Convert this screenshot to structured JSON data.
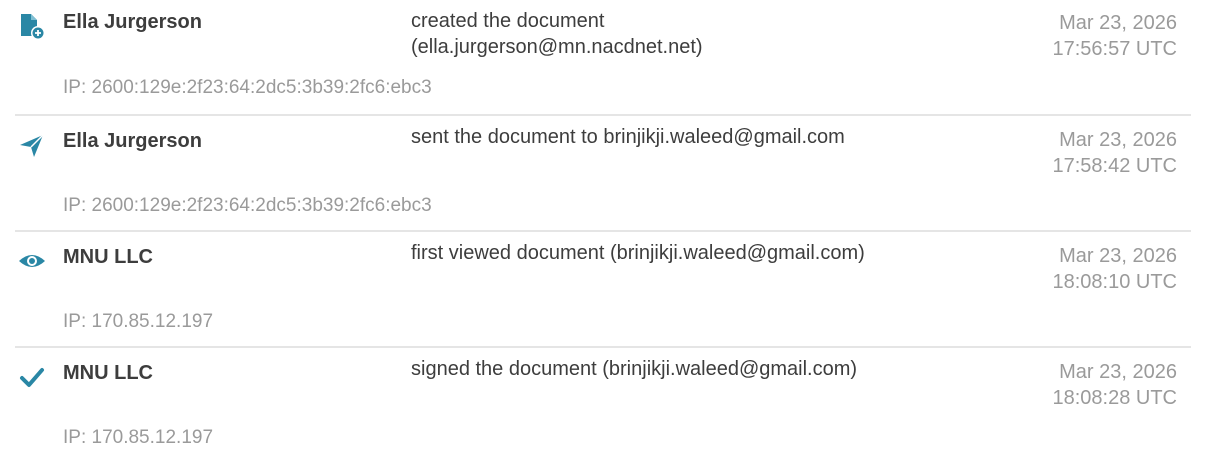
{
  "colors": {
    "accent": "#2a87a5",
    "text": "#3d3d3d",
    "muted": "#9a9a9a",
    "divider": "#e5e5e5"
  },
  "entries": [
    {
      "icon": "document-add-icon",
      "actor": "Ella Jurgerson",
      "action_line1": "created the document",
      "action_line2": "(ella.jurgerson@mn.nacdnet.net)",
      "date": "Mar 23, 2026",
      "time": "17:56:57 UTC",
      "ip": "IP: 2600:129e:2f23:64:2dc5:3b39:2fc6:ebc3"
    },
    {
      "icon": "paper-plane-icon",
      "actor": "Ella Jurgerson",
      "action_line1": "sent the document to brinjikji.waleed@gmail.com",
      "date": "Mar 23, 2026",
      "time": "17:58:42 UTC",
      "ip": "IP: 2600:129e:2f23:64:2dc5:3b39:2fc6:ebc3"
    },
    {
      "icon": "eye-icon",
      "actor": "MNU LLC",
      "action_line1": "first viewed document (brinjikji.waleed@gmail.com)",
      "date": "Mar 23, 2026",
      "time": "18:08:10 UTC",
      "ip": "IP: 170.85.12.197"
    },
    {
      "icon": "checkmark-icon",
      "actor": "MNU LLC",
      "action_line1": "signed the document (brinjikji.waleed@gmail.com)",
      "date": "Mar 23, 2026",
      "time": "18:08:28 UTC",
      "ip": "IP: 170.85.12.197"
    }
  ]
}
